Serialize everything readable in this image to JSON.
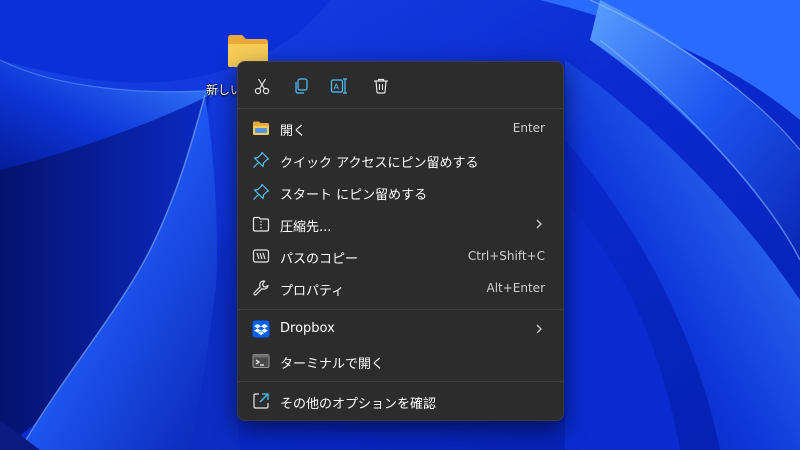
{
  "desktop": {
    "folder_label": "新しいフォルダー"
  },
  "toolbar": {
    "cut_icon": "scissors-icon",
    "copy_icon": "copy-icon",
    "rename_icon": "rename-icon",
    "delete_icon": "trash-icon"
  },
  "menu": {
    "items": [
      {
        "label": "開く",
        "shortcut": "Enter",
        "icon": "folder-icon"
      },
      {
        "label": "クイック アクセスにピン留めする",
        "shortcut": "",
        "icon": "pin-icon"
      },
      {
        "label": "スタート にピン留めする",
        "shortcut": "",
        "icon": "pin-icon"
      },
      {
        "label": "圧縮先...",
        "shortcut": "",
        "icon": "archive-icon",
        "submenu": true
      },
      {
        "label": "パスのコピー",
        "shortcut": "Ctrl+Shift+C",
        "icon": "path-icon"
      },
      {
        "label": "プロパティ",
        "shortcut": "Alt+Enter",
        "icon": "wrench-icon"
      },
      {
        "label": "Dropbox",
        "shortcut": "",
        "icon": "dropbox-icon",
        "submenu": true
      },
      {
        "label": "ターミナルで開く",
        "shortcut": "",
        "icon": "terminal-icon"
      },
      {
        "label": "その他のオプションを確認",
        "shortcut": "",
        "icon": "more-options-icon"
      }
    ]
  },
  "colors": {
    "menu_bg": "#2c2c2c",
    "accent_blue": "#4cc2ff",
    "dropbox": "#0061fe",
    "folder": "#f6c443"
  }
}
